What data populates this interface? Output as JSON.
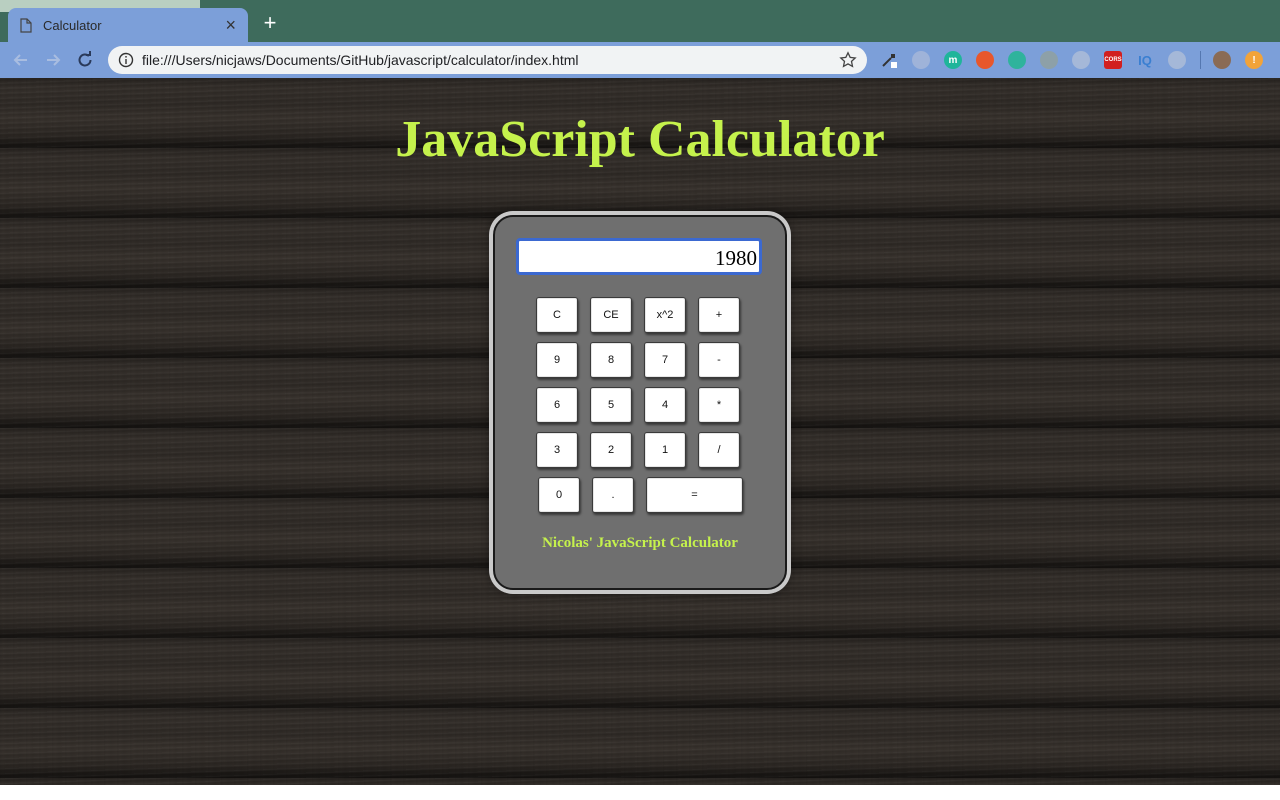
{
  "browser": {
    "tab_title": "Calculator",
    "tab_close": "×",
    "new_tab": "+",
    "url": "file:///Users/nicjaws/Documents/GitHub/javascript/calculator/index.html",
    "extensions": [
      {
        "name": "eyedropper-extension-icon",
        "color": "#4a4a4a",
        "label": ""
      },
      {
        "name": "circle-extension-icon",
        "color": "#9fb3d9",
        "label": ""
      },
      {
        "name": "m-extension-icon",
        "color": "#1fb59a",
        "label": "m"
      },
      {
        "name": "fire-extension-icon",
        "color": "#e8572b",
        "label": ""
      },
      {
        "name": "react-extension-icon",
        "color": "#2fb39c",
        "label": ""
      },
      {
        "name": "vue-extension-icon",
        "color": "#8da0a8",
        "label": ""
      },
      {
        "name": "target-extension-icon",
        "color": "#a5b8d8",
        "label": ""
      },
      {
        "name": "cors-extension-icon",
        "color": "#d11f1f",
        "label": "CORS"
      },
      {
        "name": "iq-extension-icon",
        "color": "#7c9fd9",
        "label": "IQ"
      },
      {
        "name": "gear-extension-icon",
        "color": "#a5b8d8",
        "label": ""
      }
    ]
  },
  "page": {
    "title": "JavaScript Calculator",
    "footer": "Nicolas' JavaScript Calculator"
  },
  "calculator": {
    "display_value": "1980",
    "rows": [
      [
        "C",
        "CE",
        "x^2",
        "+"
      ],
      [
        "9",
        "8",
        "7",
        "-"
      ],
      [
        "6",
        "5",
        "4",
        "*"
      ],
      [
        "3",
        "2",
        "1",
        "/"
      ],
      [
        "0",
        ".",
        "="
      ]
    ]
  }
}
